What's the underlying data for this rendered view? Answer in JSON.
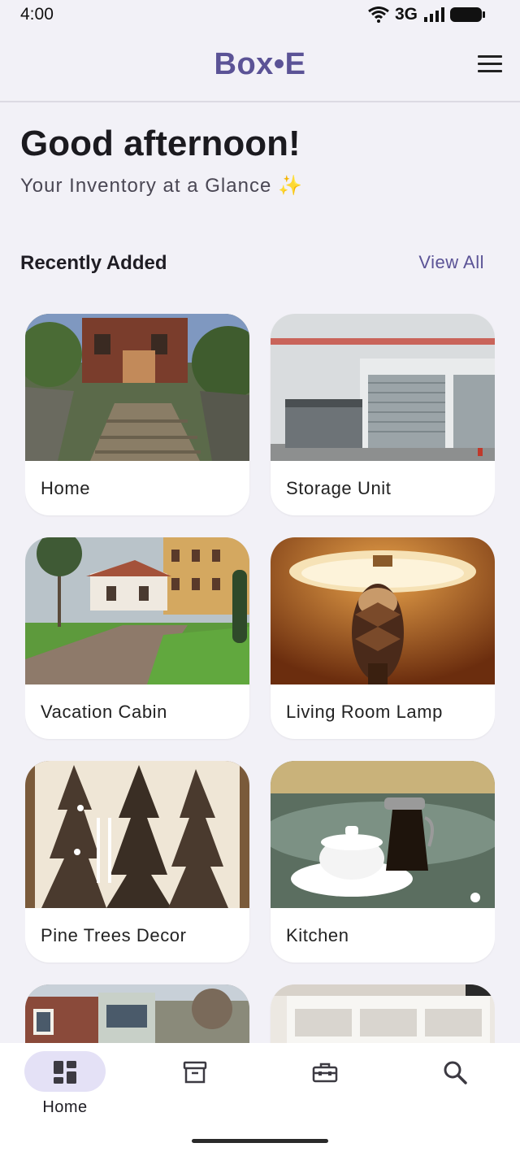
{
  "status_bar": {
    "time": "4:00",
    "network": "3G"
  },
  "app": {
    "logo": "Box•E"
  },
  "header": {
    "greeting": "Good afternoon!",
    "subtitle": "Your Inventory at a Glance ✨"
  },
  "recent": {
    "title": "Recently Added",
    "view_all": "View All",
    "items": [
      {
        "label": "Home",
        "image": "house-on-hill-photo"
      },
      {
        "label": "Storage Unit",
        "image": "storage-garage-photo"
      },
      {
        "label": "Vacation Cabin",
        "image": "villa-garden-photo"
      },
      {
        "label": "Living Room Lamp",
        "image": "pineapple-lamp-photo"
      },
      {
        "label": "Pine Trees Decor",
        "image": "pine-tree-art-photo"
      },
      {
        "label": "Kitchen",
        "image": "tea-set-table-photo"
      },
      {
        "label": "",
        "image": "brick-house-photo"
      },
      {
        "label": "",
        "image": "white-shelf-photo"
      }
    ]
  },
  "bottom_nav": {
    "items": [
      {
        "label": "Home",
        "icon": "dashboard-icon",
        "active": true
      },
      {
        "label": "",
        "icon": "archive-box-icon"
      },
      {
        "label": "",
        "icon": "toolbox-icon"
      },
      {
        "label": "",
        "icon": "search-icon"
      }
    ]
  },
  "colors": {
    "accent": "#5b5396",
    "nav_active_pill": "#e4e1f6",
    "background": "#f2f1f7"
  }
}
